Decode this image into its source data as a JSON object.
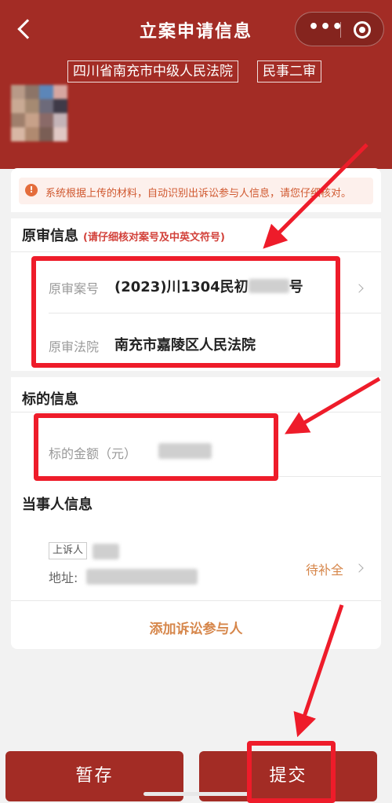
{
  "header": {
    "title": "立案申请信息",
    "court_tag": "四川省南充市中级人民法院",
    "case_type_tag": "民事二审",
    "more_icon": "•••"
  },
  "notice": {
    "text": "系统根据上传的材料，自动识别出诉讼参与人信息，请您仔细核对。",
    "icon": "!"
  },
  "original_trial": {
    "title": "原审信息",
    "hint": "(请仔细核对案号及中英文符号)",
    "case_no_label": "原审案号",
    "case_no_prefix": "(2023)川1304民初",
    "case_no_suffix": "号",
    "court_label": "原审法院",
    "court_value": "南充市嘉陵区人民法院"
  },
  "subject": {
    "title": "标的信息",
    "amount_label": "标的金额（元）"
  },
  "party": {
    "title": "当事人信息",
    "role_badge": "上诉人",
    "address_label": "地址:",
    "status": "待补全",
    "add_link": "添加诉讼参与人"
  },
  "footer": {
    "save_label": "暂存",
    "submit_label": "提交"
  },
  "colors": {
    "brand": "#a32c25",
    "accent": "#d6864a",
    "highlight": "#ee1c2a"
  }
}
